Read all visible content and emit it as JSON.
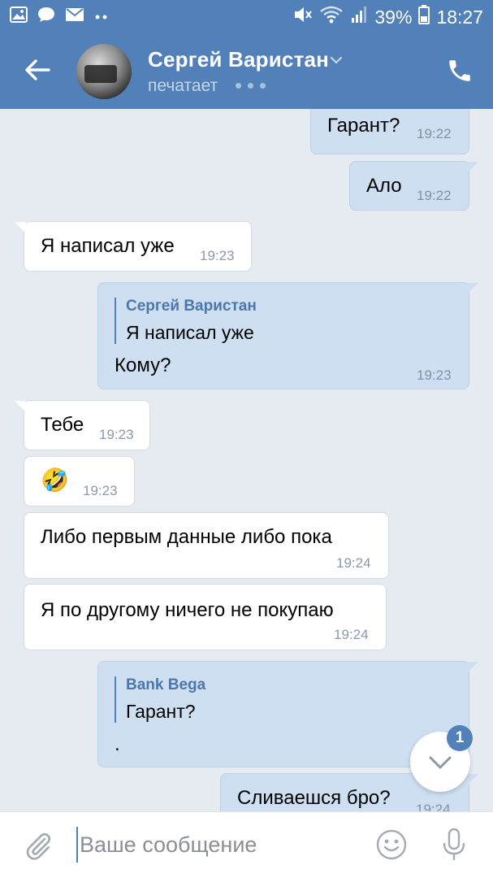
{
  "status_bar": {
    "battery": "39%",
    "time": "18:27",
    "left_icons": [
      "gallery-icon",
      "chat-icon",
      "mail-icon",
      "more-icon"
    ],
    "right_icons": [
      "mute-icon",
      "wifi-icon",
      "signal-icon",
      "battery-icon"
    ]
  },
  "header": {
    "contact_name": "Сергей Варистан",
    "status": "печатает",
    "accent": "#5181b8"
  },
  "messages": [
    {
      "dir": "out",
      "text": "Гарант?",
      "time": "19:22"
    },
    {
      "dir": "out",
      "text": "Ало",
      "time": "19:22"
    },
    {
      "dir": "in",
      "text": "Я написал уже",
      "time": "19:23"
    },
    {
      "dir": "out",
      "reply_author": "Сергей Варистан",
      "reply_text": "Я написал уже",
      "text": "Кому?",
      "time": "19:23"
    },
    {
      "dir": "in",
      "text": "Тебе",
      "time": "19:23"
    },
    {
      "dir": "in",
      "emoji": "🤣",
      "time": "19:23"
    },
    {
      "dir": "in",
      "text": "Либо первым данные либо пока",
      "time": "19:24"
    },
    {
      "dir": "in",
      "text": "Я по другому ничего не покупаю",
      "time": "19:24"
    },
    {
      "dir": "out",
      "reply_author": "Bank Bega",
      "reply_text": "Гарант?",
      "text": ".",
      "time": ""
    },
    {
      "dir": "out",
      "text": "Сливаешся бро?",
      "time": "19:24"
    }
  ],
  "scroll_down": {
    "badge": "1"
  },
  "composer": {
    "placeholder": "Ваше сообщение"
  }
}
